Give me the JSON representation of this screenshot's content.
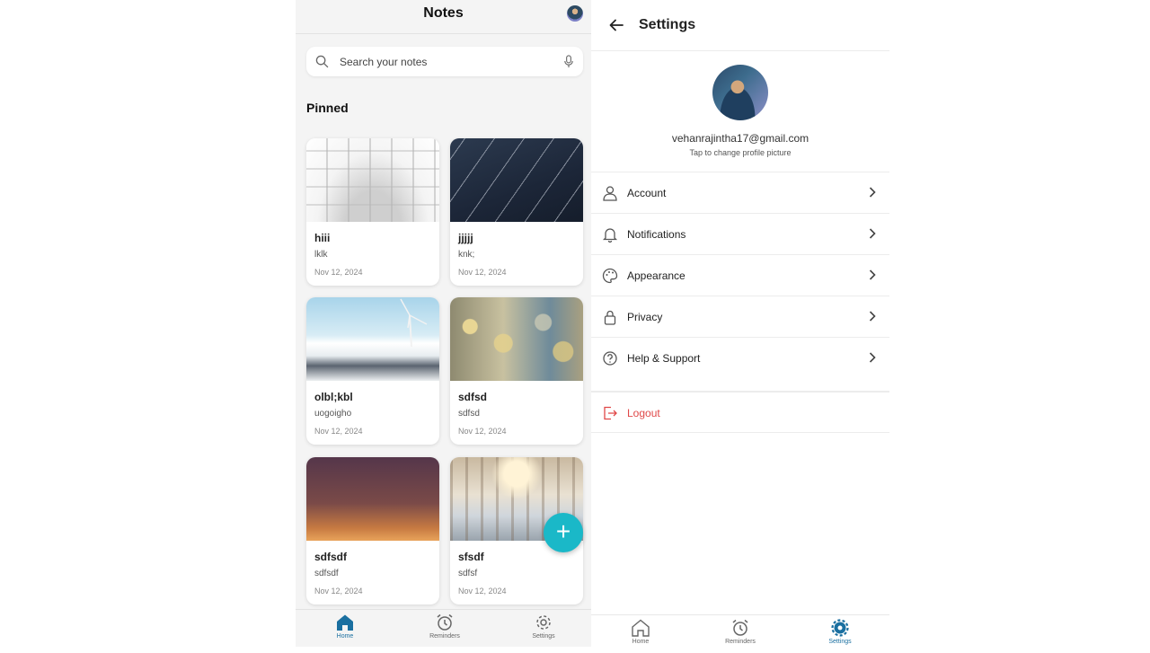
{
  "notes_screen": {
    "title": "Notes",
    "search": {
      "placeholder": "Search your notes"
    },
    "section_title": "Pinned",
    "notes": [
      {
        "title": "hiii",
        "body": "lklk",
        "date": "Nov 12, 2024",
        "image": "glass-dome"
      },
      {
        "title": "jjjjj",
        "body": "knk;",
        "date": "Nov 12, 2024",
        "image": "night-sky-stars"
      },
      {
        "title": "olbl;kbl",
        "body": "uogoigho",
        "date": "Nov 12, 2024",
        "image": "wind-turbine-snow"
      },
      {
        "title": "sdfsd",
        "body": "sdfsd",
        "date": "Nov 12, 2024",
        "image": "bokeh-lights"
      },
      {
        "title": "sdfsdf",
        "body": "sdfsdf",
        "date": "Nov 12, 2024",
        "image": "dusk-sky"
      },
      {
        "title": "sfsdf",
        "body": "sdfsf",
        "date": "Nov 12, 2024",
        "image": "crowded-hall"
      }
    ],
    "fab": {
      "icon": "plus-icon",
      "label": "+"
    },
    "bottom_nav": [
      {
        "label": "Home",
        "icon": "home-icon",
        "active": true
      },
      {
        "label": "Reminders",
        "icon": "alarm-clock-icon",
        "active": false
      },
      {
        "label": "Settings",
        "icon": "gear-icon",
        "active": false
      }
    ]
  },
  "settings_screen": {
    "title": "Settings",
    "profile": {
      "email": "vehanrajintha17@gmail.com",
      "hint": "Tap to change profile picture"
    },
    "menu": [
      {
        "label": "Account",
        "icon": "user-icon"
      },
      {
        "label": "Notifications",
        "icon": "bell-icon"
      },
      {
        "label": "Appearance",
        "icon": "palette-icon"
      },
      {
        "label": "Privacy",
        "icon": "lock-icon"
      },
      {
        "label": "Help & Support",
        "icon": "help-circle-icon"
      }
    ],
    "logout": {
      "label": "Logout",
      "icon": "logout-icon",
      "color": "#e04848"
    },
    "bottom_nav": [
      {
        "label": "Home",
        "icon": "home-icon",
        "active": false
      },
      {
        "label": "Reminders",
        "icon": "alarm-clock-icon",
        "active": false
      },
      {
        "label": "Settings",
        "icon": "gear-icon",
        "active": true
      }
    ]
  },
  "colors": {
    "accent": "#1ab8c8",
    "active_nav": "#1a6fa0",
    "logout": "#e04848"
  }
}
